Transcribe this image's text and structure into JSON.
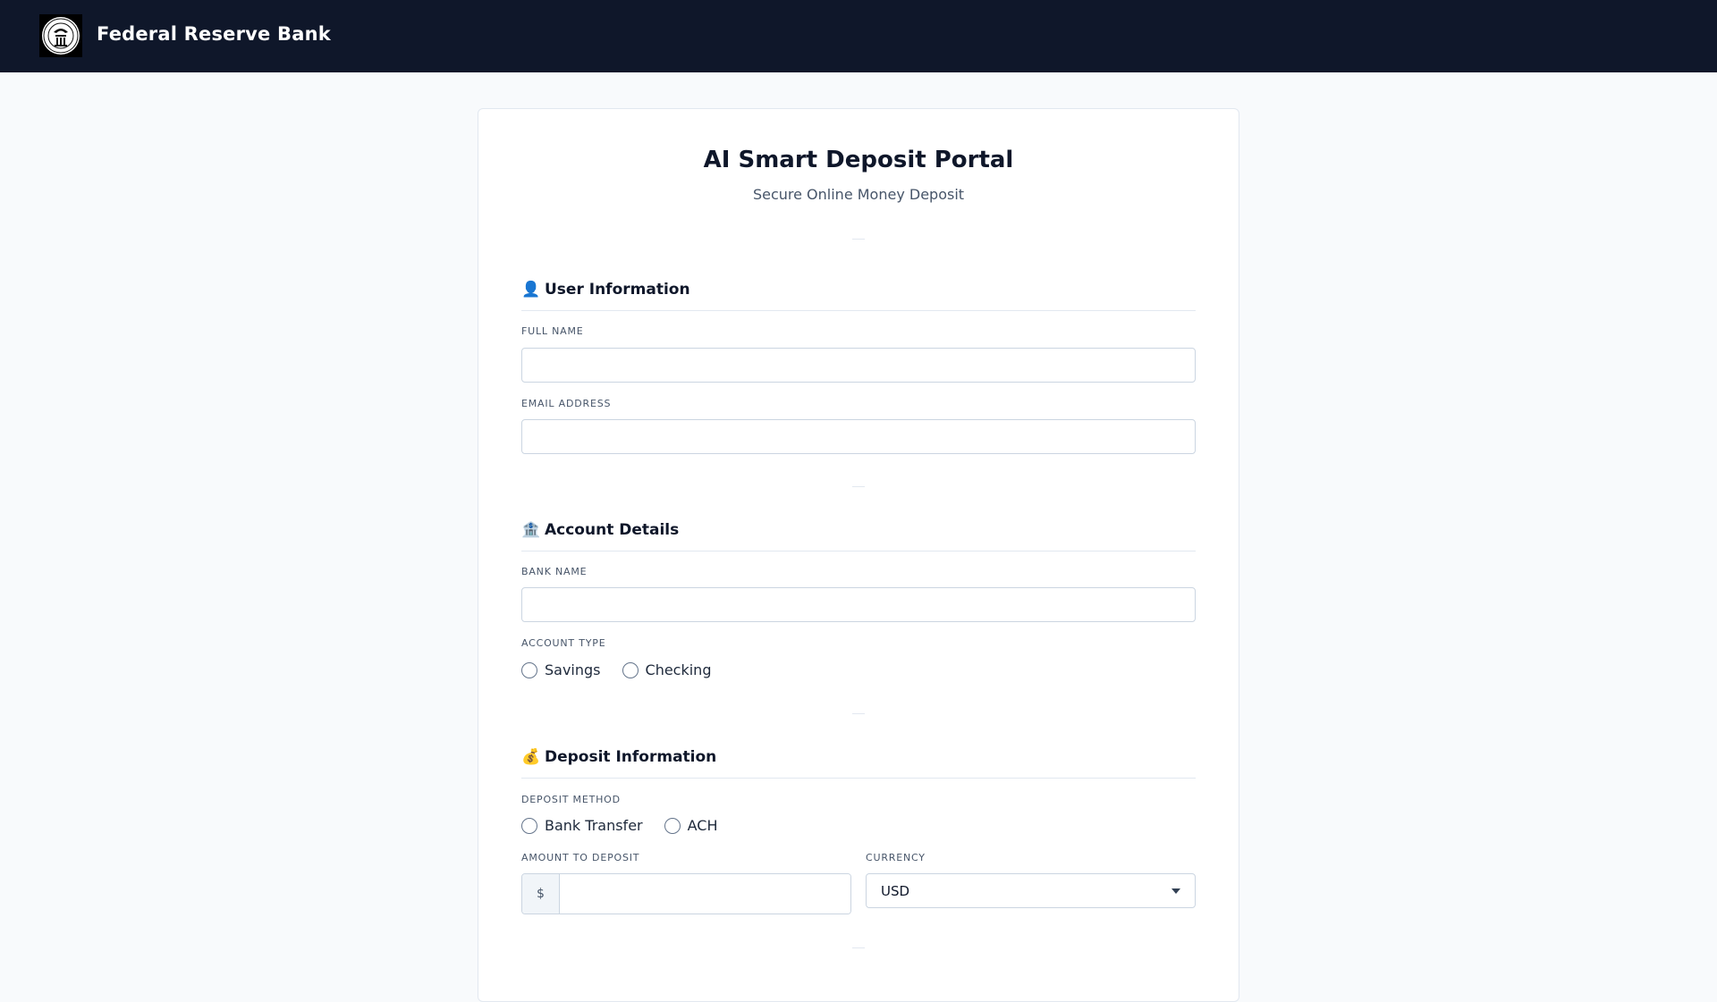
{
  "header": {
    "bank_name": "Federal Reserve Bank",
    "logo_icon": "federal-reserve-seal"
  },
  "portal": {
    "title": "AI Smart Deposit Portal",
    "subtitle": "Secure Online Money Deposit"
  },
  "sections": {
    "user": {
      "icon": "👤",
      "heading": "User Information",
      "full_name_label": "FULL NAME",
      "full_name_value": "",
      "email_label": "EMAIL ADDRESS",
      "email_value": ""
    },
    "account": {
      "icon": "🏦",
      "heading": "Account Details",
      "bank_name_label": "BANK NAME",
      "bank_name_value": "",
      "account_type_label": "ACCOUNT TYPE",
      "account_types": [
        "Savings",
        "Checking"
      ]
    },
    "deposit": {
      "icon": "💰",
      "heading": "Deposit Information",
      "method_label": "DEPOSIT METHOD",
      "methods": [
        "Bank Transfer",
        "ACH"
      ],
      "amount_label": "AMOUNT TO DEPOSIT",
      "currency_symbol": "$",
      "amount_value": "",
      "currency_label": "CURRENCY",
      "currency_selected": "USD"
    }
  },
  "colors": {
    "header_bg": "#0f172a",
    "page_bg": "#f8fafc",
    "card_border": "#e2e8f0"
  }
}
